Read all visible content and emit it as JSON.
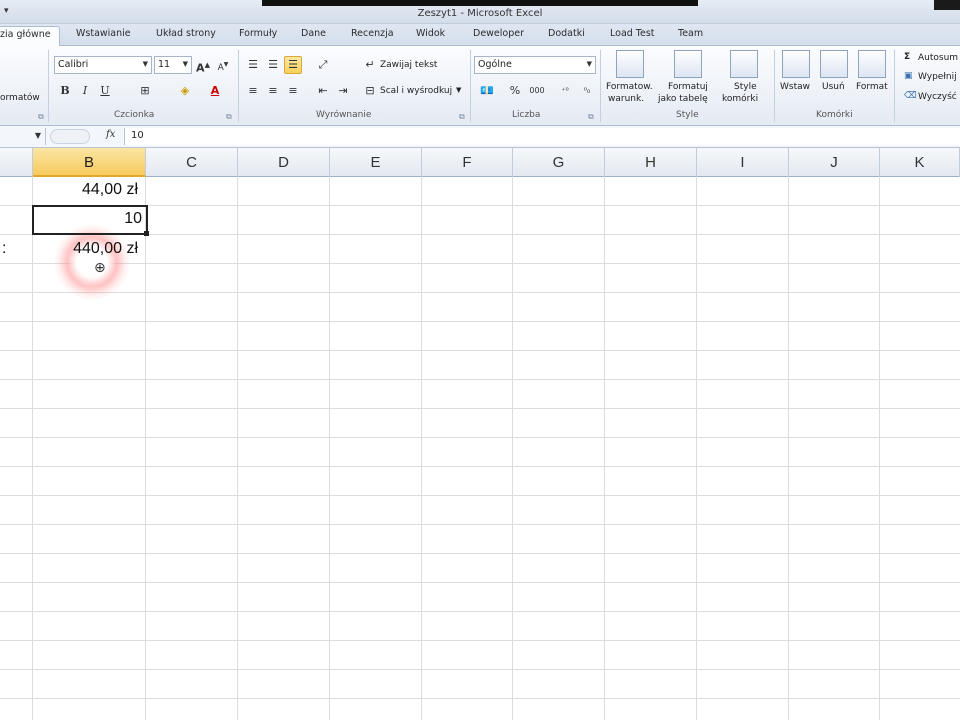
{
  "window": {
    "title": "Zeszyt1 - Microsoft Excel"
  },
  "tabs": [
    {
      "label": "zia główne",
      "active": true
    },
    {
      "label": "Wstawianie"
    },
    {
      "label": "Układ strony"
    },
    {
      "label": "Formuły"
    },
    {
      "label": "Dane"
    },
    {
      "label": "Recenzja"
    },
    {
      "label": "Widok"
    },
    {
      "label": "Deweloper"
    },
    {
      "label": "Dodatki"
    },
    {
      "label": "Load Test"
    },
    {
      "label": "Team"
    }
  ],
  "ribbon": {
    "clipboard_fragment": "ormatów",
    "font": {
      "name": "Calibri",
      "size": "11",
      "group_label": "Czcionka"
    },
    "alignment": {
      "wrap_text": "Zawijaj tekst",
      "merge_center": "Scal i wyśrodkuj",
      "group_label": "Wyrównanie"
    },
    "number": {
      "format": "Ogólne",
      "group_label": "Liczba"
    },
    "styles": {
      "conditional": [
        "Formatow.",
        "warunk."
      ],
      "as_table": [
        "Formatuj",
        "jako tabelę"
      ],
      "cell_styles": [
        "Style",
        "komórki"
      ],
      "group_label": "Style"
    },
    "cells": {
      "insert": "Wstaw",
      "delete": "Usuń",
      "format": "Format",
      "group_label": "Komórki"
    },
    "editing": {
      "autosum": "Autosum",
      "fill": "Wypełnij",
      "clear": "Wyczyść"
    }
  },
  "formula_bar": {
    "fx": "fx",
    "value": "10"
  },
  "columns": [
    "B",
    "C",
    "D",
    "E",
    "F",
    "G",
    "H",
    "I",
    "J",
    "K"
  ],
  "selected_column": "B",
  "cells": [
    {
      "ref": "B1",
      "text": "44,00 zł"
    },
    {
      "ref": "B2",
      "text": "10"
    },
    {
      "ref": "A3",
      "text": ":"
    },
    {
      "ref": "B3",
      "text": "440,00 zł"
    }
  ],
  "colors": {
    "accent": "#f7cb5c",
    "ribbon": "#eef2f8",
    "grid": "#dadcdd"
  }
}
